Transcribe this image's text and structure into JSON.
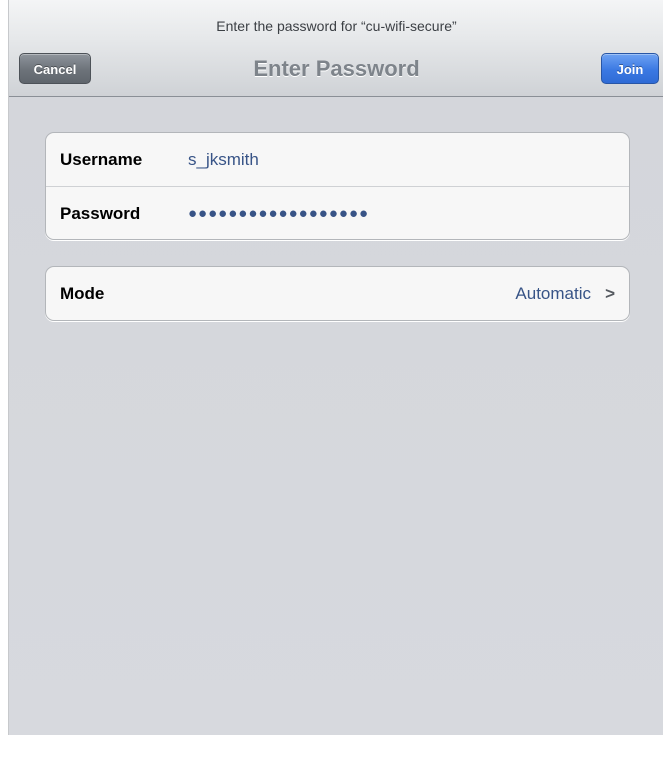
{
  "nav": {
    "prompt": "Enter the password for “cu-wifi-secure”",
    "title": "Enter Password",
    "cancel_label": "Cancel",
    "join_label": "Join"
  },
  "credentials": {
    "username_label": "Username",
    "username_value": "s_jksmith",
    "password_label": "Password",
    "password_mask": "●●●●●●●●●●●●●●●●●●"
  },
  "mode": {
    "label": "Mode",
    "value": "Automatic",
    "chevron_icon": "chevron-right-icon"
  },
  "colors": {
    "value_text": "#385487",
    "join_button": "#3b79e3",
    "cancel_button": "#6d737a",
    "background": "#d6d8dc"
  }
}
